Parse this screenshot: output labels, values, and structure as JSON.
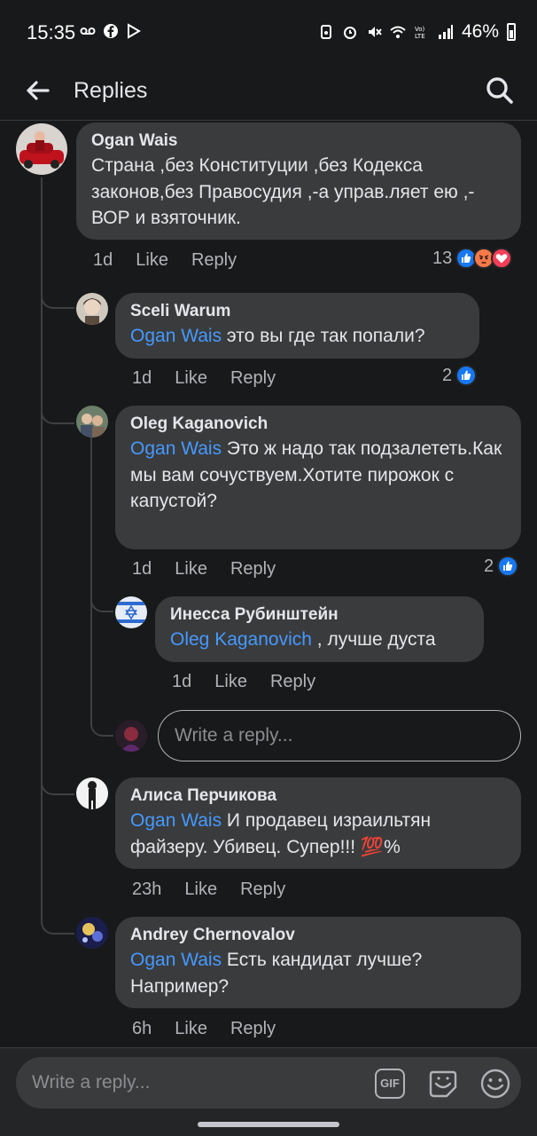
{
  "status_bar": {
    "time": "15:35",
    "battery": "46%"
  },
  "header": {
    "title": "Replies"
  },
  "comments": [
    {
      "author": "Ogan Wais",
      "text": "Страна ,без Конституции ,без Кодекса законов,без Правосудия ,-а управ.ляет ею ,-ВОР и взяточник.",
      "time": "1d",
      "like": "Like",
      "reply": "Reply",
      "reaction_count": "13",
      "reactions": [
        "like",
        "angry",
        "love"
      ]
    },
    {
      "author": "Sceli Warum",
      "mention": "Ogan Wais",
      "text": " это вы где так попали?",
      "time": "1d",
      "like": "Like",
      "reply": "Reply",
      "reaction_count": "2",
      "reactions": [
        "like"
      ]
    },
    {
      "author": "Oleg Kaganovich",
      "mention": "Ogan Wais",
      "text": " Это ж надо так подзалететь.Как мы вам сочуствуем.Хотите пирожок с капустой?",
      "time": "1d",
      "like": "Like",
      "reply": "Reply",
      "reaction_count": "2",
      "reactions": [
        "like"
      ]
    },
    {
      "author": "Инесса Рубинштейн",
      "mention": "Oleg Kaganovich",
      "text": " , лучше дуста",
      "time": "1d",
      "like": "Like",
      "reply": "Reply"
    },
    {
      "author": "Алиса Перчикова",
      "mention": "Ogan Wais",
      "text": " И продавец израильтян файзеру. Убивец.  Супер!!! 💯%",
      "time": "23h",
      "like": "Like",
      "reply": "Reply"
    },
    {
      "author": "Andrey Chernovalov",
      "mention": "Ogan Wais",
      "text": " Есть кандидат лучше? Например?",
      "time": "6h",
      "like": "Like",
      "reply": "Reply"
    }
  ],
  "inline_reply": {
    "placeholder": "Write a reply..."
  },
  "composer": {
    "placeholder": "Write a reply...",
    "gif_label": "GIF"
  },
  "colors": {
    "background": "#18191a",
    "bubble": "#3a3b3c",
    "mention": "#4599ff",
    "like_blue": "#1877f2"
  }
}
